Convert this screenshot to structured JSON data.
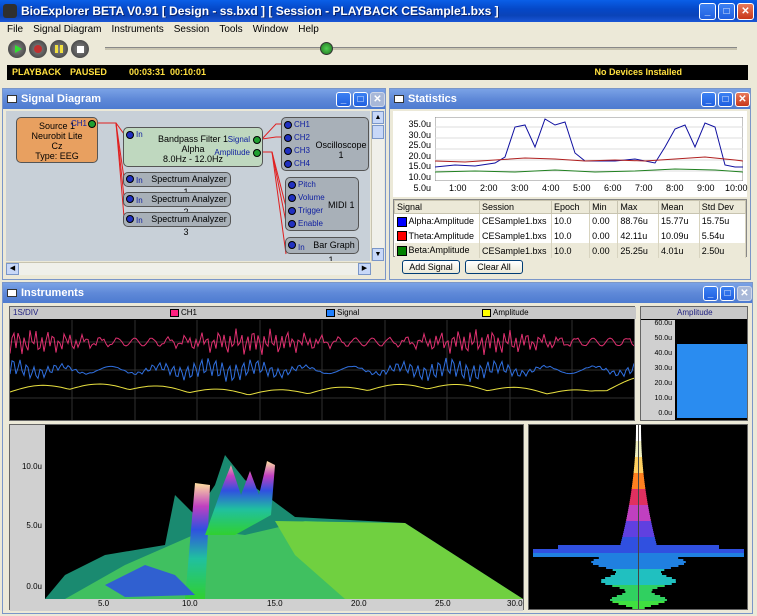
{
  "app": {
    "title": "BioExplorer BETA V0.91  [ Design - ss.bxd ] [ Session - PLAYBACK CESample1.bxs ]"
  },
  "menu": [
    "File",
    "Signal Diagram",
    "Instruments",
    "Session",
    "Tools",
    "Window",
    "Help"
  ],
  "status": {
    "mode": "PLAYBACK",
    "state": "PAUSED",
    "time1": "00:03:31",
    "time2": "00:10:01",
    "devices": "No Devices Installed",
    "playback_position": 0.35
  },
  "signal_diagram": {
    "title": "Signal Diagram",
    "source": {
      "line1": "Source 1",
      "line2": "Neurobit Lite",
      "line3": "Cz",
      "line4": "Type: EEG",
      "port": "CH1"
    },
    "filter": {
      "in": "In",
      "line1": "Bandpass Filter 1",
      "line2": "Alpha",
      "line3": "8.0Hz - 12.0Hz",
      "out1": "Signal",
      "out2": "Amplitude"
    },
    "oscilloscope": {
      "title": "Oscilloscope 1",
      "ports": [
        "CH1",
        "CH2",
        "CH3",
        "CH4"
      ]
    },
    "spectrum": [
      {
        "in": "In",
        "label": "Spectrum Analyzer 1"
      },
      {
        "in": "In",
        "label": "Spectrum Analyzer 2"
      },
      {
        "in": "In",
        "label": "Spectrum Analyzer 3"
      }
    ],
    "midi": {
      "title": "MIDI 1",
      "ports": [
        "Pitch",
        "Volume",
        "Trigger",
        "Enable"
      ]
    },
    "bargraph": {
      "in": "In",
      "label": "Bar Graph 1"
    }
  },
  "statistics": {
    "title": "Statistics",
    "yticks": [
      "35.0u",
      "30.0u",
      "25.0u",
      "20.0u",
      "15.0u",
      "10.0u",
      "5.0u"
    ],
    "xticks": [
      "1:00",
      "2:00",
      "3:00",
      "4:00",
      "5:00",
      "6:00",
      "7:00",
      "8:00",
      "9:00",
      "10:00"
    ],
    "columns": [
      "Signal",
      "Session",
      "Epoch",
      "Min",
      "Max",
      "Mean",
      "Std Dev"
    ],
    "rows": [
      {
        "color": "#0000ff",
        "signal": "Alpha:Amplitude",
        "session": "CESample1.bxs",
        "epoch": "10.0",
        "min": "0.00",
        "max": "88.76u",
        "mean": "15.77u",
        "std": "15.75u"
      },
      {
        "color": "#ff0000",
        "signal": "Theta:Amplitude",
        "session": "CESample1.bxs",
        "epoch": "10.0",
        "min": "0.00",
        "max": "42.11u",
        "mean": "10.09u",
        "std": "5.54u"
      },
      {
        "color": "#008000",
        "signal": "Beta:Amplitude",
        "session": "CESample1.bxs",
        "epoch": "10.0",
        "min": "0.00",
        "max": "25.25u",
        "mean": "4.01u",
        "std": "2.50u"
      }
    ],
    "add_signal": "Add Signal",
    "clear_all": "Clear All"
  },
  "instruments": {
    "title": "Instruments",
    "scale": "1S/DIV",
    "legend": [
      {
        "label": "CH1",
        "color": "#ff2080"
      },
      {
        "label": "Signal",
        "color": "#2080ff"
      },
      {
        "label": "Amplitude",
        "color": "#ffff00"
      }
    ],
    "bar": {
      "title": "Amplitude",
      "ticks": [
        "60.0u",
        "50.0u",
        "40.0u",
        "30.0u",
        "20.0u",
        "10.0u",
        "0.0u"
      ],
      "value_fraction": 0.78
    },
    "spectrum3d": {
      "yticks": [
        "10.0u",
        "5.0u",
        "0.0u"
      ],
      "xticks": [
        "5.0",
        "10.0",
        "15.0",
        "20.0",
        "25.0",
        "30.0"
      ]
    }
  }
}
